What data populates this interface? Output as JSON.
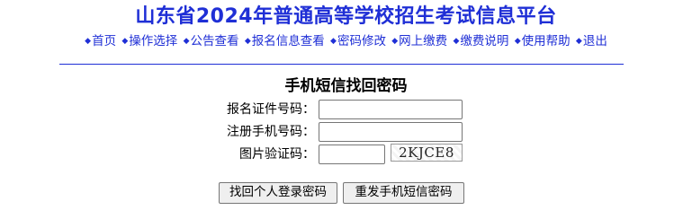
{
  "header": {
    "title": "山东省2024年普通高等学校招生考试信息平台"
  },
  "nav": {
    "bullet": "◆",
    "items": [
      {
        "label": "首页"
      },
      {
        "label": "操作选择"
      },
      {
        "label": "公告查看"
      },
      {
        "label": "报名信息查看"
      },
      {
        "label": "密码修改"
      },
      {
        "label": "网上缴费"
      },
      {
        "label": "缴费说明"
      },
      {
        "label": "使用帮助"
      },
      {
        "label": "退出"
      }
    ]
  },
  "form": {
    "title": "手机短信找回密码",
    "fields": {
      "id_number": {
        "label": "报名证件号码：",
        "value": ""
      },
      "phone": {
        "label": "注册手机号码：",
        "value": ""
      },
      "captcha": {
        "label": "图片验证码：",
        "value": ""
      }
    },
    "captcha_image_text": "2KJCE8",
    "buttons": {
      "retrieve": "找回个人登录密码",
      "resend": "重发手机短信密码"
    }
  },
  "colors": {
    "accent": "#1f2fd6"
  }
}
